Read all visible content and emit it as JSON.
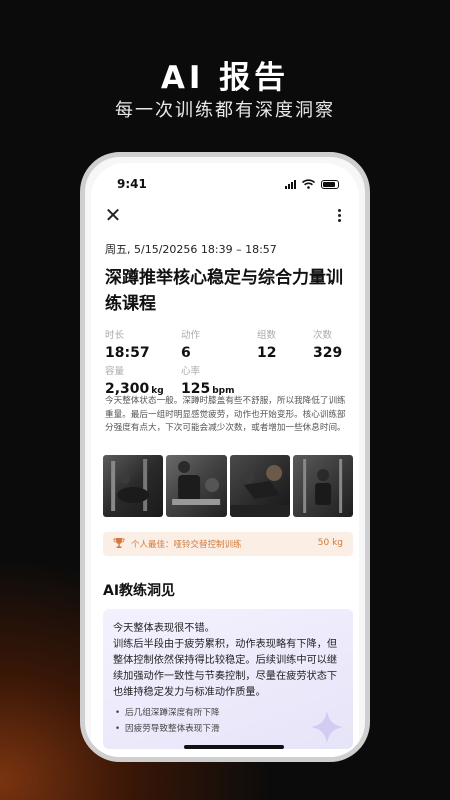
{
  "promo": {
    "title": "AI 报告",
    "subtitle": "每一次训练都有深度洞察"
  },
  "status_bar": {
    "time": "9:41",
    "icons": [
      "signal-icon",
      "wifi-icon",
      "battery-icon"
    ]
  },
  "toolbar": {
    "close_icon": "close-icon",
    "more_icon": "more-vertical-icon"
  },
  "session": {
    "datetime": "周五, 5/15/20256 18:39 – 18:57",
    "title": "深蹲推举核心稳定与综合力量训练课程"
  },
  "stats": [
    {
      "label": "时长",
      "value": "18:57",
      "unit": ""
    },
    {
      "label": "动作",
      "value": "6",
      "unit": ""
    },
    {
      "label": "组数",
      "value": "12",
      "unit": ""
    },
    {
      "label": "次数",
      "value": "329",
      "unit": ""
    },
    {
      "label": "容量",
      "value": "2,300",
      "unit": "kg"
    },
    {
      "label": "心率",
      "value": "125",
      "unit": "bpm"
    }
  ],
  "note": "今天整体状态一般。深蹲时膝盖有些不舒服，所以我降低了训练重量。最后一组时明显感觉疲劳，动作也开始变形。核心训练部分强度有点大，下次可能会减少次数，或者增加一些休息时间。",
  "photos": [
    "workout-photo-1",
    "workout-photo-2",
    "workout-photo-3",
    "workout-photo-4"
  ],
  "personal_best": {
    "icon": "trophy-icon",
    "label": "个人最佳：哑铃交替控制训练",
    "value": "50 kg"
  },
  "ai_coach": {
    "title": "AI教练洞见",
    "summary": "今天整体表现很不错。",
    "body": "训练后半段由于疲劳累积，动作表现略有下降，但整体控制依然保持得比较稳定。后续训练中可以继续加强动作一致性与节奏控制，尽量在疲劳状态下也维持稳定发力与标准动作质量。",
    "bullets": [
      "后几组深蹲深度有所下降",
      "因疲劳导致整体表现下滑"
    ]
  },
  "colors": {
    "accent": "#d07a3e",
    "personal_best_bg": "#fbeee5",
    "coach_card_bg": "#efecfd"
  }
}
